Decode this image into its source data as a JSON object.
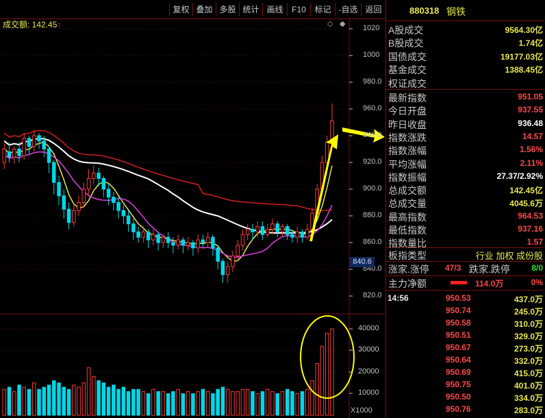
{
  "toolbar": {
    "buttons": [
      "复权",
      "叠加",
      "多股",
      "统计",
      "画线",
      "F10",
      "标记",
      "-自选",
      "返回"
    ]
  },
  "chart": {
    "volume_label": "成交额: 142.45",
    "up_arrow": "↑",
    "diamond": "◇",
    "plus": "◆",
    "price_axis": [
      "1020",
      "1000",
      "980.0",
      "960.0",
      "940.0",
      "920.0",
      "900.0",
      "880.0",
      "860.0",
      "840.0",
      "820.0"
    ],
    "current_price_tag": "840.6",
    "volume_axis": [
      "40000",
      "30000",
      "20000",
      "10000"
    ],
    "volume_unit": "X1000"
  },
  "chart_data": {
    "type": "candlestick",
    "ylim": [
      815,
      1025
    ],
    "volume_ylim": [
      0,
      42000
    ],
    "candles": [
      [
        920,
        930,
        915,
        934
      ],
      [
        928,
        924,
        920,
        935
      ],
      [
        924,
        930,
        919,
        932
      ],
      [
        930,
        925,
        920,
        935
      ],
      [
        925,
        938,
        922,
        942
      ],
      [
        938,
        932,
        926,
        940
      ],
      [
        932,
        940,
        928,
        944
      ],
      [
        940,
        936,
        930,
        942
      ],
      [
        936,
        930,
        924,
        940
      ],
      [
        930,
        920,
        912,
        932
      ],
      [
        920,
        905,
        896,
        922
      ],
      [
        905,
        895,
        888,
        910
      ],
      [
        895,
        885,
        878,
        900
      ],
      [
        885,
        875,
        870,
        890
      ],
      [
        875,
        884,
        872,
        888
      ],
      [
        884,
        890,
        880,
        895
      ],
      [
        890,
        900,
        886,
        905
      ],
      [
        900,
        908,
        896,
        915
      ],
      [
        908,
        912,
        904,
        918
      ],
      [
        912,
        908,
        902,
        916
      ],
      [
        908,
        900,
        894,
        910
      ],
      [
        900,
        894,
        888,
        904
      ],
      [
        894,
        890,
        884,
        898
      ],
      [
        890,
        884,
        878,
        894
      ],
      [
        884,
        880,
        874,
        888
      ],
      [
        880,
        874,
        868,
        884
      ],
      [
        874,
        868,
        862,
        878
      ],
      [
        868,
        864,
        860,
        872
      ],
      [
        864,
        868,
        860,
        872
      ],
      [
        868,
        862,
        856,
        870
      ],
      [
        862,
        866,
        858,
        870
      ],
      [
        866,
        860,
        854,
        868
      ],
      [
        860,
        864,
        856,
        866
      ],
      [
        864,
        860,
        856,
        868
      ],
      [
        860,
        858,
        852,
        864
      ],
      [
        858,
        862,
        855,
        866
      ],
      [
        862,
        858,
        852,
        864
      ],
      [
        858,
        860,
        854,
        864
      ],
      [
        860,
        856,
        850,
        862
      ],
      [
        856,
        862,
        852,
        866
      ],
      [
        862,
        860,
        856,
        866
      ],
      [
        860,
        864,
        856,
        868
      ],
      [
        864,
        856,
        850,
        866
      ],
      [
        856,
        846,
        840,
        858
      ],
      [
        846,
        836,
        830,
        848
      ],
      [
        836,
        842,
        830,
        846
      ],
      [
        842,
        850,
        838,
        854
      ],
      [
        850,
        858,
        846,
        862
      ],
      [
        858,
        866,
        854,
        870
      ],
      [
        866,
        870,
        862,
        874
      ],
      [
        870,
        868,
        862,
        874
      ],
      [
        868,
        872,
        864,
        876
      ],
      [
        872,
        866,
        862,
        876
      ],
      [
        866,
        870,
        864,
        874
      ],
      [
        870,
        874,
        866,
        878
      ],
      [
        874,
        868,
        864,
        876
      ],
      [
        868,
        872,
        864,
        874
      ],
      [
        872,
        866,
        862,
        874
      ],
      [
        866,
        864,
        860,
        870
      ],
      [
        864,
        868,
        860,
        872
      ],
      [
        868,
        864,
        860,
        870
      ],
      [
        864,
        870,
        862,
        874
      ],
      [
        870,
        882,
        868,
        886
      ],
      [
        882,
        900,
        878,
        904
      ],
      [
        900,
        920,
        896,
        925
      ],
      [
        920,
        935,
        914,
        940
      ],
      [
        935,
        951,
        930,
        964
      ]
    ],
    "volumes": [
      12,
      13,
      11,
      14,
      13,
      12,
      15,
      12,
      13,
      14,
      16,
      15,
      13,
      12,
      14,
      13,
      15,
      22,
      18,
      16,
      15,
      13,
      14,
      12,
      13,
      11,
      12,
      12,
      11,
      10,
      12,
      11,
      11,
      10,
      11,
      12,
      10,
      11,
      10,
      11,
      12,
      11,
      10,
      12,
      13,
      12,
      11,
      11,
      12,
      12,
      11,
      10,
      11,
      12,
      11,
      10,
      11,
      12,
      11,
      10,
      11,
      12,
      16,
      24,
      32,
      38,
      40
    ]
  },
  "panel": {
    "code": "880318",
    "name": "钢铁",
    "rows_top": [
      {
        "k": "A股成交",
        "v": "9564.30亿",
        "c": "yellow"
      },
      {
        "k": "B股成交",
        "v": "1.74亿",
        "c": "yellow"
      },
      {
        "k": "国债成交",
        "v": "19177.03亿",
        "c": "yellow"
      },
      {
        "k": "基金成交",
        "v": "1388.45亿",
        "c": "yellow"
      },
      {
        "k": "权证成交",
        "v": "",
        "c": "yellow"
      }
    ],
    "rows_mid": [
      {
        "k": "最新指数",
        "v": "951.05",
        "c": "red"
      },
      {
        "k": "今日开盘",
        "v": "937.55",
        "c": "red"
      },
      {
        "k": "昨日收盘",
        "v": "936.48",
        "c": "white"
      },
      {
        "k": "指数涨跌",
        "v": "14.57",
        "c": "red"
      },
      {
        "k": "指数涨幅",
        "v": "1.56%",
        "c": "red"
      },
      {
        "k": "平均涨幅",
        "v": "2.11%",
        "c": "red"
      },
      {
        "k": "指数振幅",
        "v": "27.37/2.92%",
        "c": "white"
      },
      {
        "k": "总成交额",
        "v": "142.45亿",
        "c": "yellow"
      },
      {
        "k": "总成交量",
        "v": "4045.6万",
        "c": "yellow"
      },
      {
        "k": "最高指数",
        "v": "964.53",
        "c": "red"
      },
      {
        "k": "最低指数",
        "v": "937.16",
        "c": "red"
      },
      {
        "k": "指数量比",
        "v": "1.57",
        "c": "red"
      }
    ],
    "sector_type": {
      "k": "板指类型",
      "v": "行业 加权 成份股"
    },
    "limit_row": {
      "k1": "涨家.涨停",
      "v1": "47/3",
      "k2": "跌家.跌停",
      "v2": "8/0"
    },
    "main_force": {
      "k": "主力净额",
      "v": "114.0万",
      "pct": "0%"
    },
    "ticks_time": "14:56",
    "ticks": [
      {
        "p": "950.53",
        "q": "437.0万"
      },
      {
        "p": "950.74",
        "q": "245.0万"
      },
      {
        "p": "950.58",
        "q": "310.0万"
      },
      {
        "p": "950.51",
        "q": "329.0万"
      },
      {
        "p": "950.67",
        "q": "273.0万"
      },
      {
        "p": "950.64",
        "q": "332.0万"
      },
      {
        "p": "950.69",
        "q": "415.0万"
      },
      {
        "p": "950.75",
        "q": "401.0万"
      },
      {
        "p": "950.50",
        "q": "334.0万"
      },
      {
        "p": "950.76",
        "q": "283.0万"
      }
    ]
  },
  "colors": {
    "up": "#ff3c3c",
    "down": "#00d8e8",
    "accent": "#e8e850",
    "border": "#7a1010"
  }
}
